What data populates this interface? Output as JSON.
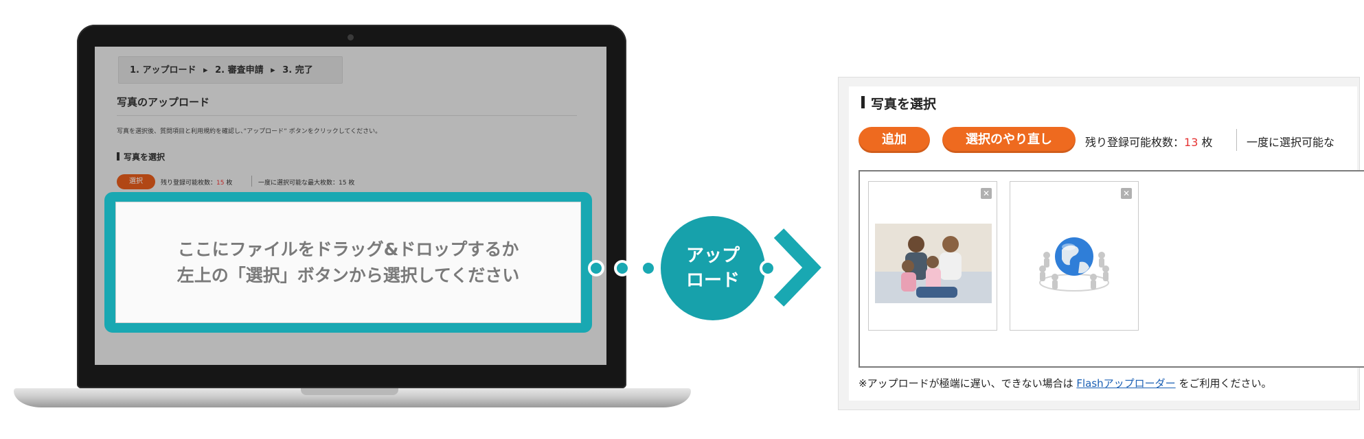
{
  "laptop_screen": {
    "steps": [
      "1. アップロード",
      "▸",
      "2. 審査申請",
      "▸",
      "3. 完了"
    ],
    "heading": "写真のアップロード",
    "description": "写真を選択後、質問項目と利用規約を確認し、”アップロード” ボタンをクリックしてください。",
    "sub_heading": "写真を選択",
    "select_button": "選択",
    "remaining_label": "残り登録可能枚数：",
    "remaining_count": "15",
    "remaining_unit": "枚",
    "max_select_label": "一度に選択可能な最大枚数：15 枚",
    "drop_line1": "ここにファイルをドラッグ&ドロップするか",
    "drop_line2": "左上の「選択」ボタンから選択してください"
  },
  "connector": {
    "upload_line1": "アップ",
    "upload_line2": "ロード"
  },
  "panel": {
    "title": "写真を選択",
    "add_button": "追加",
    "reselect_button": "選択のやり直し",
    "remaining_label": "残り登録可能枚数：",
    "remaining_count": "13",
    "remaining_unit": "枚",
    "max_select_label": "一度に選択可能な",
    "thumbnails": [
      {
        "close": "✕",
        "icon": "family-photo-icon"
      },
      {
        "close": "✕",
        "icon": "globe-network-icon"
      }
    ],
    "note_prefix": "※アップロードが極端に遅い、できない場合は",
    "note_link": "Flashアップローダー",
    "note_suffix": "をご利用ください。"
  },
  "colors": {
    "teal": "#19a8b2",
    "orange": "#ee6a1f",
    "count_red": "#e53333",
    "link_blue": "#1a5fb4"
  }
}
